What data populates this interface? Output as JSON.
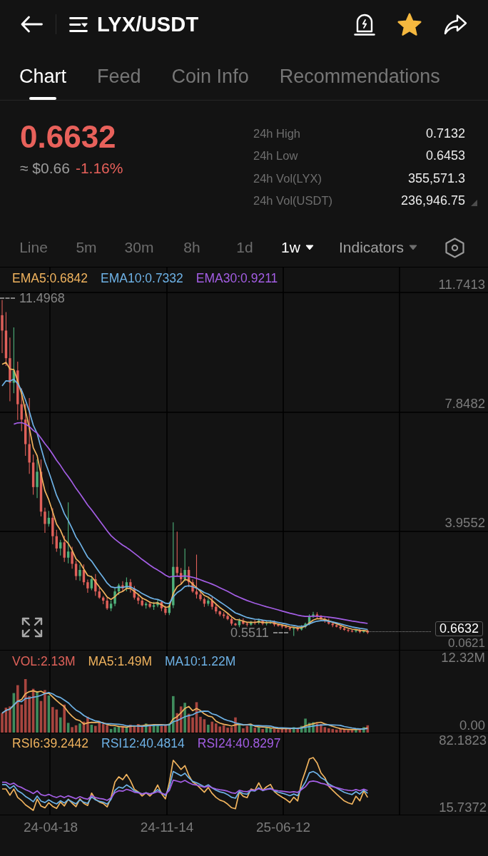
{
  "header": {
    "title": "LYX/USDT",
    "favorite": true
  },
  "tabs": [
    {
      "label": "Chart",
      "selected": true
    },
    {
      "label": "Feed",
      "selected": false
    },
    {
      "label": "Coin Info",
      "selected": false
    },
    {
      "label": "Recommendations",
      "selected": false
    }
  ],
  "price": {
    "last": "0.6632",
    "fiat": "≈ $0.66",
    "change": "-1.16%",
    "down": true
  },
  "stats": [
    {
      "label": "24h High",
      "value": "0.7132"
    },
    {
      "label": "24h Low",
      "value": "0.6453"
    },
    {
      "label": "24h Vol(LYX)",
      "value": "355,571.3"
    },
    {
      "label": "24h Vol(USDT)",
      "value": "236,946.75"
    }
  ],
  "intervals": [
    {
      "label": "Line",
      "selected": false,
      "dropdown": false
    },
    {
      "label": "5m",
      "selected": false,
      "dropdown": false
    },
    {
      "label": "30m",
      "selected": false,
      "dropdown": false
    },
    {
      "label": "8h",
      "selected": false,
      "dropdown": false
    },
    {
      "label": "1d",
      "selected": false,
      "dropdown": false
    },
    {
      "label": "1w",
      "selected": true,
      "dropdown": true
    }
  ],
  "indicators": {
    "label": "Indicators"
  },
  "price_chart": {
    "legend": [
      {
        "label": "EMA5:0.6842",
        "color": "#f0b35e"
      },
      {
        "label": "EMA10:0.7332",
        "color": "#6eb2e6"
      },
      {
        "label": "EMA30:0.9211",
        "color": "#a45ee5"
      }
    ],
    "y_axis": [
      "11.7413",
      "7.8482",
      "3.9552",
      "0.0621"
    ],
    "high_marker": "11.4968",
    "low_marker": "0.5511",
    "last_price": "0.6632"
  },
  "volume_chart": {
    "legend": [
      {
        "label": "VOL:2.13M",
        "color": "#e0625a"
      },
      {
        "label": "MA5:1.49M",
        "color": "#f0b35e"
      },
      {
        "label": "MA10:1.22M",
        "color": "#6eb2e6"
      }
    ],
    "y_axis": [
      "12.32M",
      "0.00"
    ]
  },
  "rsi_chart": {
    "legend": [
      {
        "label": "RSI6:39.2442",
        "color": "#f0b35e"
      },
      {
        "label": "RSI12:40.4814",
        "color": "#6eb2e6"
      },
      {
        "label": "RSI24:40.8297",
        "color": "#a45ee5"
      }
    ],
    "y_axis": [
      "82.1823",
      "15.7372"
    ]
  },
  "x_axis": [
    "24-04-18",
    "24-11-14",
    "25-06-12"
  ]
}
